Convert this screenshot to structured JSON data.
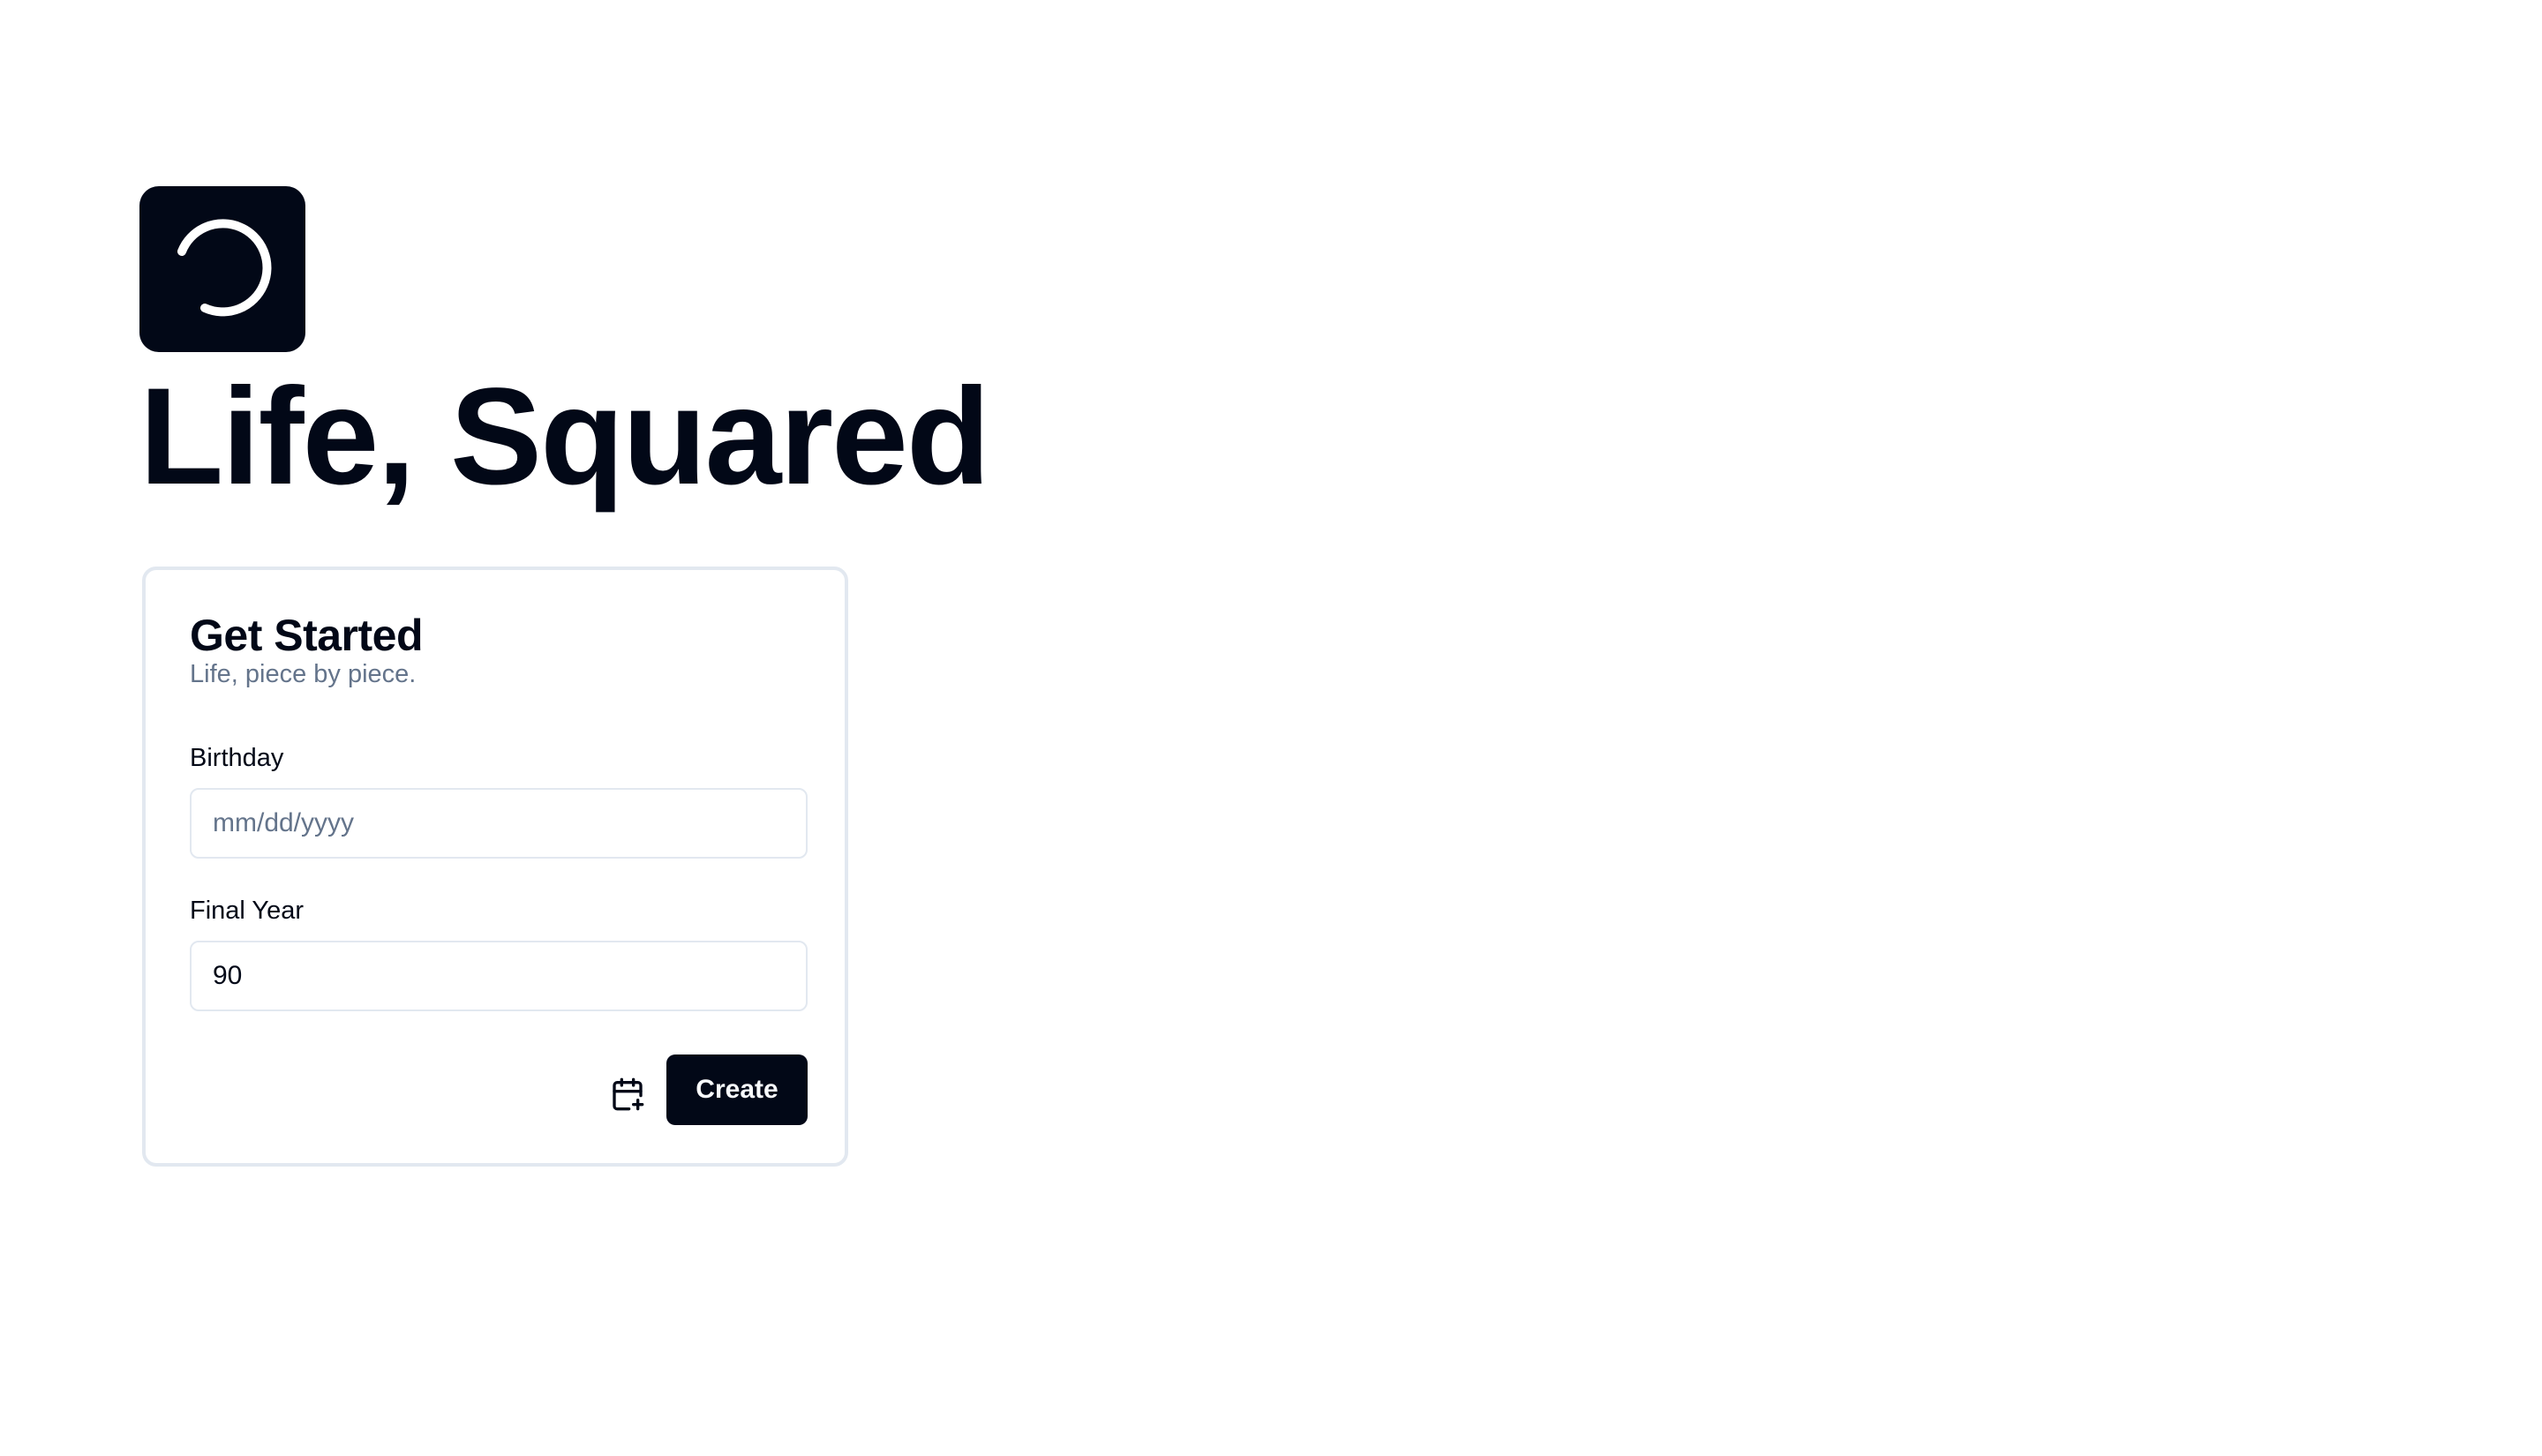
{
  "app": {
    "title": "Life, Squared",
    "logo_icon": "circular-arrow-logo-icon"
  },
  "card": {
    "title": "Get Started",
    "subtitle": "Life, piece by piece.",
    "birthday": {
      "label": "Birthday",
      "placeholder": "mm/dd/yyyy",
      "value": ""
    },
    "final_year": {
      "label": "Final Year",
      "value": "90"
    },
    "calendar_icon": "calendar-plus-icon",
    "create_label": "Create"
  },
  "colors": {
    "primary": "#020817",
    "muted_text": "#64748b",
    "border": "#e2e8f0",
    "background": "#ffffff"
  }
}
